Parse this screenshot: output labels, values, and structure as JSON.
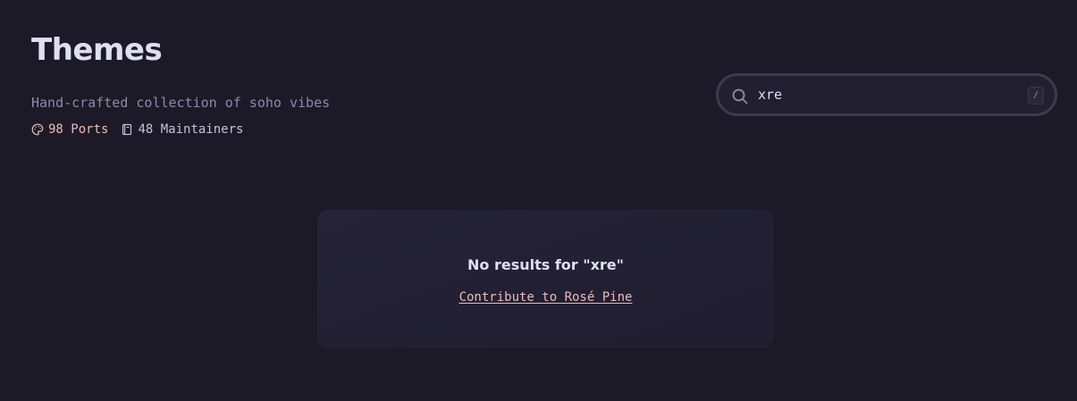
{
  "header": {
    "title": "Themes",
    "subtitle": "Hand-crafted collection of soho vibes"
  },
  "stats": {
    "ports": {
      "icon": "palette-icon",
      "label": "98 Ports"
    },
    "maintainers": {
      "icon": "book-icon",
      "label": "48 Maintainers"
    }
  },
  "search": {
    "icon": "search-icon",
    "value": "xre",
    "shortcut": "/"
  },
  "empty_state": {
    "message": "No results for \"xre\"",
    "link_label": "Contribute to Rosé Pine"
  },
  "colors": {
    "background": "#1c1a26",
    "text": "#e0def4",
    "muted": "#8e8aa8",
    "accent_rose": "#ebbcba",
    "card": "#242136",
    "search_border": "#3e3a52"
  }
}
